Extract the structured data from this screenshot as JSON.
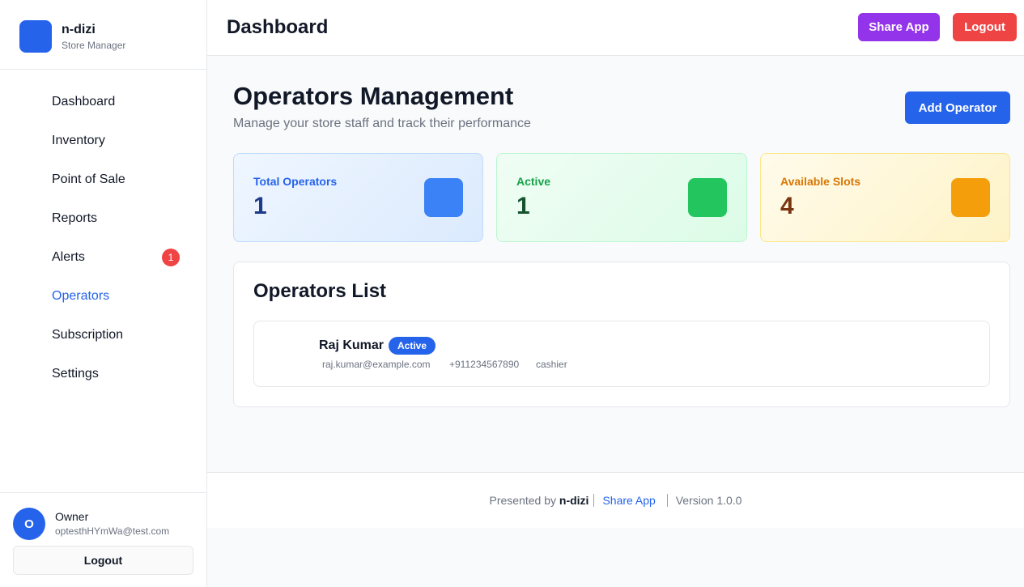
{
  "brand": {
    "name": "n-dizi",
    "subtitle": "Store Manager"
  },
  "sidebar": {
    "items": [
      {
        "label": "Dashboard"
      },
      {
        "label": "Inventory"
      },
      {
        "label": "Point of Sale"
      },
      {
        "label": "Reports"
      },
      {
        "label": "Alerts",
        "badge": "1"
      },
      {
        "label": "Operators",
        "active": true
      },
      {
        "label": "Subscription"
      },
      {
        "label": "Settings"
      }
    ]
  },
  "user": {
    "initial": "O",
    "name": "Owner",
    "email": "optesthHYmWa@test.com",
    "logout_label": "Logout"
  },
  "header": {
    "title": "Dashboard",
    "share_label": "Share App",
    "logout_label": "Logout"
  },
  "page": {
    "title": "Operators Management",
    "subtitle": "Manage your store staff and track their performance",
    "add_label": "Add Operator"
  },
  "stats": [
    {
      "label": "Total Operators",
      "value": "1"
    },
    {
      "label": "Active",
      "value": "1"
    },
    {
      "label": "Available Slots",
      "value": "4"
    }
  ],
  "operators_list": {
    "title": "Operators List",
    "rows": [
      {
        "name": "Raj Kumar",
        "status": "Active",
        "email": "raj.kumar@example.com",
        "phone": "+911234567890",
        "role": "cashier"
      }
    ]
  },
  "footer": {
    "presented_by": "Presented by",
    "brand": "n-dizi",
    "share_label": "Share App",
    "version": "Version 1.0.0"
  },
  "colors": {
    "primary": "#2563eb",
    "share": "#9333ea",
    "danger": "#ef4444",
    "success": "#22c55e",
    "warning": "#f59e0b"
  }
}
